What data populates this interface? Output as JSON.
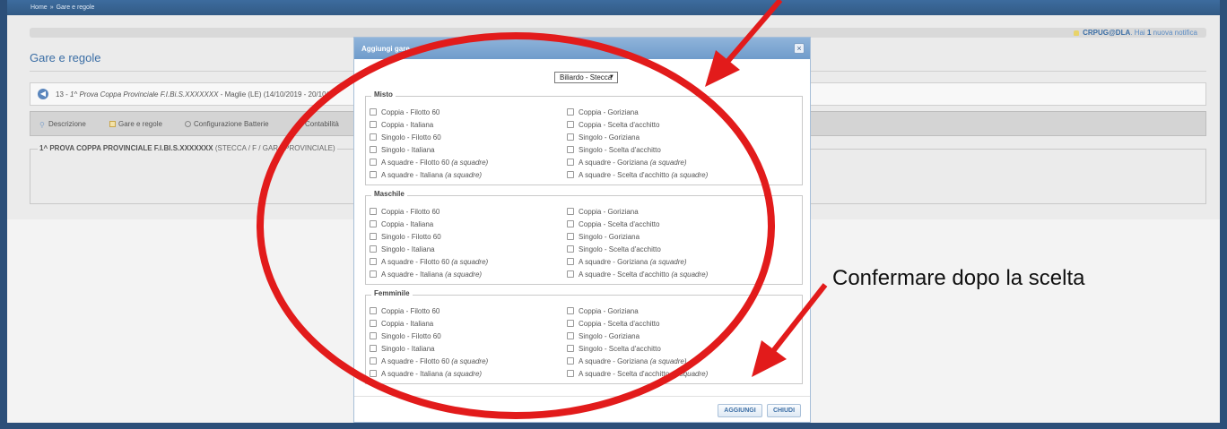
{
  "breadcrumb": {
    "home": "Home",
    "separator": "»",
    "current": "Gare e regole"
  },
  "notification": {
    "user": "CRPUG@DLA",
    "text_before": "Hai",
    "count": "1",
    "text_after": "nuova notifica"
  },
  "page": {
    "title": "Gare e regole",
    "info_prefix": "13 - ",
    "info_event": "1^ Prova Coppa Provinciale F.I.Bi.S.XXXXXXX",
    "info_suffix": " - Maglie (LE) (14/10/2019 - 20/10/2"
  },
  "tabs": [
    {
      "label": "Descrizione"
    },
    {
      "label": "Gare e regole"
    },
    {
      "label": "Configurazione Batterie"
    },
    {
      "label": "Contabilità"
    }
  ],
  "section": {
    "title": "1^ PROVA COPPA PROVINCIALE F.I.BI.S.XXXXXXX",
    "detail": " (STECCA / F / GARA PROVINCIALE)"
  },
  "modal": {
    "title": "Aggiungi gare",
    "close_glyph": "×",
    "select_value": "Biliardo - Stecca",
    "select_arrow": "▼",
    "groups": [
      {
        "legend": "Misto"
      },
      {
        "legend": "Maschile"
      },
      {
        "legend": "Femminile"
      }
    ],
    "options_left": [
      {
        "label": "Coppia - Filotto 60",
        "note": ""
      },
      {
        "label": "Coppia - Italiana",
        "note": ""
      },
      {
        "label": "Singolo - Filotto 60",
        "note": ""
      },
      {
        "label": "Singolo - Italiana",
        "note": ""
      },
      {
        "label": "A squadre - Filotto 60 ",
        "note": "(a squadre)"
      },
      {
        "label": "A squadre - Italiana ",
        "note": "(a squadre)"
      }
    ],
    "options_right": [
      {
        "label": "Coppia - Goriziana",
        "note": ""
      },
      {
        "label": "Coppia - Scelta d'acchitto",
        "note": ""
      },
      {
        "label": "Singolo - Goriziana",
        "note": ""
      },
      {
        "label": "Singolo - Scelta d'acchitto",
        "note": ""
      },
      {
        "label": "A squadre - Goriziana ",
        "note": "(a squadre)"
      },
      {
        "label": "A squadre - Scelta d'acchitto ",
        "note": "(a squadre)"
      }
    ],
    "add_button": "AGGIUNGI",
    "close_button": "CHIUDI"
  },
  "annotation": {
    "text": "Confermare dopo la scelta",
    "color": "#e21b1b"
  },
  "colors": {
    "frame": "#2c4f79",
    "accent": "#3b6ea5",
    "annotation_red": "#e21b1b"
  }
}
